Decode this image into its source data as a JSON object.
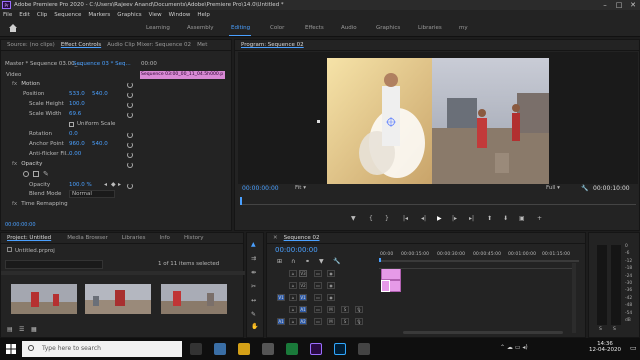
{
  "app": {
    "title": "Adobe Premiere Pro 2020 - C:\\Users\\Rajeev Anand\\Documents\\Adobe\\Premiere Pro\\14.0\\Untitled *",
    "logo": "Pr"
  },
  "menu": [
    "File",
    "Edit",
    "Clip",
    "Sequence",
    "Markers",
    "Graphics",
    "View",
    "Window",
    "Help"
  ],
  "workspaces": [
    "Learning",
    "Assembly",
    "Editing",
    "Color",
    "Effects",
    "Audio",
    "Graphics",
    "Libraries",
    "my"
  ],
  "left_top": {
    "tabs": [
      "Source: (no clips)",
      "Effect Controls",
      "Audio Clip Mixer: Sequence 02",
      "Met"
    ],
    "master": "Master * Sequence 03.00_...",
    "seq": "Sequence 03 * Seq...",
    "time": "00:00",
    "clip_label": "Sequence 03:00_00_11_04.5h000.p",
    "video_header": "Video",
    "motion": "Motion",
    "props": [
      {
        "name": "Position",
        "v1": "533.0",
        "v2": "540.0"
      },
      {
        "name": "Scale Height",
        "v1": "100.0",
        "v2": ""
      },
      {
        "name": "Scale Width",
        "v1": "69.6",
        "v2": ""
      },
      {
        "name": "Uniform Scale",
        "v1": "",
        "v2": ""
      },
      {
        "name": "Rotation",
        "v1": "0.0",
        "v2": ""
      },
      {
        "name": "Anchor Point",
        "v1": "960.0",
        "v2": "540.0"
      },
      {
        "name": "Anti-flicker Fil...",
        "v1": "0.00",
        "v2": ""
      }
    ],
    "opacity": "Opacity",
    "opacity_val": "100.0 %",
    "blend_mode": "Blend Mode",
    "blend_val": "Normal",
    "time_remap": "Time Remapping",
    "bottom_time": "00:00:00:00"
  },
  "program": {
    "tab": "Program: Sequence 02",
    "timecode": "00:00:00:00",
    "fit": "Fit",
    "full": "Full",
    "duration": "00:00:10:00"
  },
  "project": {
    "tabs": [
      "Project: Untitled",
      "Media Browser",
      "Libraries",
      "Info",
      "History"
    ],
    "file": "Untitled.prproj",
    "count": "1 of 11 items selected"
  },
  "timeline": {
    "tab": "Sequence 02",
    "timecode": "00:00:00:00",
    "ruler": [
      "00:00",
      "00:00:15:00",
      "00:00:30:00",
      "00:00:45:00",
      "00:01:00:00",
      "00:01:15:00"
    ],
    "tracks": [
      "V3",
      "V2",
      "V1",
      "A1",
      "A2"
    ],
    "src_v": "V1",
    "src_a": "A1"
  },
  "audio_meter": {
    "labels": [
      "0",
      "-6",
      "-12",
      "-18",
      "-24",
      "-30",
      "-36",
      "-42",
      "-48",
      "-54",
      "dB"
    ],
    "s": [
      "S",
      "S"
    ]
  },
  "taskbar": {
    "search": "Type here to search",
    "time": "14:36",
    "date": "12-04-2020"
  }
}
